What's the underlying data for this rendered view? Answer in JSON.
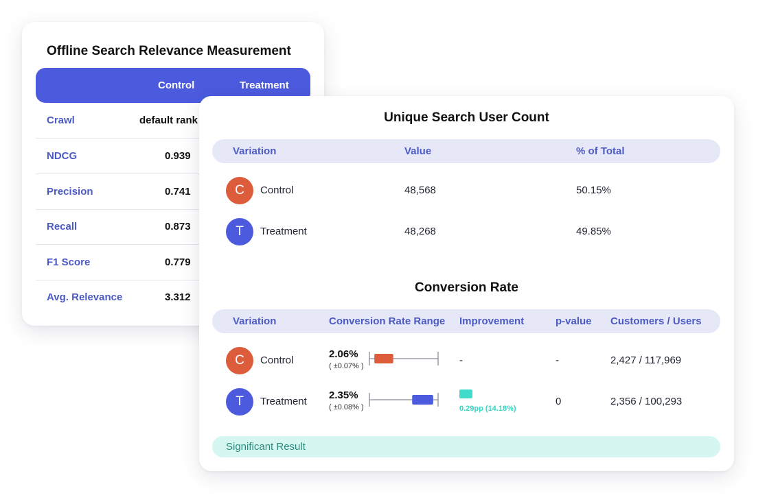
{
  "offline": {
    "title": "Offline Search Relevance Measurement",
    "columns": [
      "Control",
      "Treatment"
    ],
    "rows": [
      {
        "label": "Crawl",
        "control": "default rank"
      },
      {
        "label": "NDCG",
        "control": "0.939"
      },
      {
        "label": "Precision",
        "control": "0.741"
      },
      {
        "label": "Recall",
        "control": "0.873"
      },
      {
        "label": "F1 Score",
        "control": "0.779"
      },
      {
        "label": "Avg. Relevance",
        "control": "3.312"
      }
    ]
  },
  "unique_users": {
    "title": "Unique Search User Count",
    "headers": {
      "variation": "Variation",
      "value": "Value",
      "percent": "% of Total"
    },
    "rows": [
      {
        "initial": "C",
        "name": "Control",
        "value": "48,568",
        "percent": "50.15%"
      },
      {
        "initial": "T",
        "name": "Treatment",
        "value": "48,268",
        "percent": "49.85%"
      }
    ]
  },
  "conversion": {
    "title": "Conversion Rate",
    "headers": {
      "variation": "Variation",
      "range": "Conversion Rate Range",
      "improvement": "Improvement",
      "pvalue": "p-value",
      "customers": "Customers / Users"
    },
    "rows": [
      {
        "initial": "C",
        "name": "Control",
        "rate": "2.06%",
        "ci": "( ±0.07% )",
        "improvement": "-",
        "improvement_detail": "",
        "pvalue": "-",
        "customers": "2,427 / 117,969",
        "box_start": 0.08,
        "box_end": 0.35
      },
      {
        "initial": "T",
        "name": "Treatment",
        "rate": "2.35%",
        "ci": "( ±0.08% )",
        "improvement": "",
        "improvement_detail": "0.29pp (14.18%)",
        "pvalue": "0",
        "customers": "2,356 / 100,293",
        "box_start": 0.62,
        "box_end": 0.92
      }
    ],
    "significance": "Significant Result"
  },
  "colors": {
    "accent": "#4c5ade",
    "control": "#dd5c3b",
    "treatment": "#4c5ade",
    "improvement": "#3fdccb",
    "significant_bg": "#d6f7f1"
  }
}
